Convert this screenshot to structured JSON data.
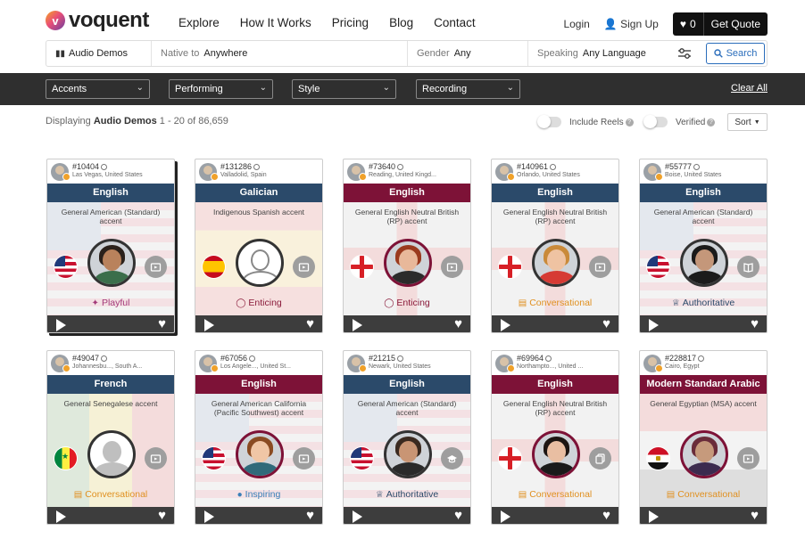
{
  "brand": {
    "name": "voquent"
  },
  "nav": {
    "links": [
      "Explore",
      "How It Works",
      "Pricing",
      "Blog",
      "Contact"
    ],
    "login": "Login",
    "signup": "Sign Up",
    "cart_count": "0",
    "get_quote": "Get Quote"
  },
  "search": {
    "category": "Audio Demos",
    "native_label": "Native to",
    "native_value": "Anywhere",
    "gender_label": "Gender",
    "gender_value": "Any",
    "speaking_label": "Speaking",
    "speaking_value": "Any Language",
    "button": "Search"
  },
  "filters": {
    "accents": "Accents",
    "performing": "Performing",
    "style": "Style",
    "recording": "Recording",
    "clear_all": "Clear All"
  },
  "results": {
    "prefix": "Displaying",
    "category": "Audio Demos",
    "range": "1 - 20 of 86,659",
    "include_reels": "Include Reels",
    "verified": "Verified",
    "sort": "Sort"
  },
  "cards": [
    {
      "id": "#10404",
      "location": "Las Vegas, United States",
      "language": "English",
      "lang_color": "blue",
      "accent": "General American (Standard) accent",
      "flag": "us",
      "style": "Playful",
      "style_class": "playful",
      "icon": "video"
    },
    {
      "id": "#131286",
      "location": "Valladolid, Spain",
      "language": "Galician",
      "lang_color": "blue",
      "accent": "Indigenous Spanish accent",
      "flag": "es",
      "style": "Enticing",
      "style_class": "enticing",
      "icon": "video"
    },
    {
      "id": "#73640",
      "location": "Reading, United Kingd...",
      "language": "English",
      "lang_color": "red",
      "accent": "General English Neutral British (RP) accent",
      "flag": "gb",
      "style": "Enticing",
      "style_class": "enticing",
      "icon": "video"
    },
    {
      "id": "#140961",
      "location": "Orlando, United States",
      "language": "English",
      "lang_color": "blue",
      "accent": "General English Neutral British (RP) accent",
      "flag": "gb",
      "style": "Conversational",
      "style_class": "conv",
      "icon": "video"
    },
    {
      "id": "#55777",
      "location": "Boise, United States",
      "language": "English",
      "lang_color": "blue",
      "accent": "General American (Standard) accent",
      "flag": "us",
      "style": "Authoritative",
      "style_class": "auth",
      "icon": "book"
    },
    {
      "id": "#49047",
      "location": "Johannesbu..., South A...",
      "language": "French",
      "lang_color": "blue",
      "accent": "General Senegalese accent",
      "flag": "sn",
      "style": "Conversational",
      "style_class": "conv",
      "icon": "video"
    },
    {
      "id": "#67056",
      "location": "Los Angele..., United St...",
      "language": "English",
      "lang_color": "red",
      "accent": "General American California (Pacific Southwest) accent",
      "flag": "us",
      "style": "Inspiring",
      "style_class": "insp",
      "icon": "video"
    },
    {
      "id": "#21215",
      "location": "Newark, United States",
      "language": "English",
      "lang_color": "blue",
      "accent": "General American (Standard) accent",
      "flag": "us",
      "style": "Authoritative",
      "style_class": "auth",
      "icon": "grad"
    },
    {
      "id": "#69964",
      "location": "Northampto..., United ...",
      "language": "English",
      "lang_color": "red",
      "accent": "General English Neutral British (RP) accent",
      "flag": "gb",
      "style": "Conversational",
      "style_class": "conv",
      "icon": "copy"
    },
    {
      "id": "#228817",
      "location": "Cairo, Egypt",
      "language": "Modern Standard Arabic",
      "lang_color": "red",
      "accent": "General Egyptian (MSA) accent",
      "flag": "eg",
      "style": "Conversational",
      "style_class": "conv",
      "icon": "video"
    }
  ]
}
